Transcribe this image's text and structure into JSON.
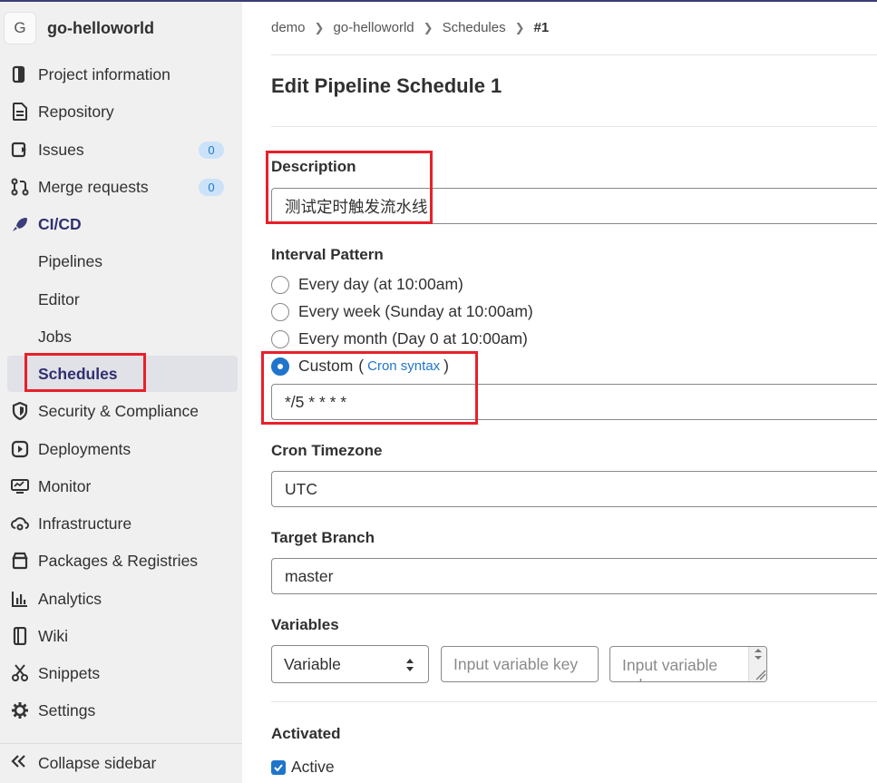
{
  "project": {
    "avatar_letter": "G",
    "name": "go-helloworld"
  },
  "sidebar": {
    "items": [
      {
        "label": "Project information"
      },
      {
        "label": "Repository"
      },
      {
        "label": "Issues",
        "badge": "0"
      },
      {
        "label": "Merge requests",
        "badge": "0"
      },
      {
        "label": "CI/CD"
      },
      {
        "label": "Pipelines"
      },
      {
        "label": "Editor"
      },
      {
        "label": "Jobs"
      },
      {
        "label": "Schedules"
      },
      {
        "label": "Security & Compliance"
      },
      {
        "label": "Deployments"
      },
      {
        "label": "Monitor"
      },
      {
        "label": "Infrastructure"
      },
      {
        "label": "Packages & Registries"
      },
      {
        "label": "Analytics"
      },
      {
        "label": "Wiki"
      },
      {
        "label": "Snippets"
      },
      {
        "label": "Settings"
      }
    ],
    "collapse_label": "Collapse sidebar"
  },
  "breadcrumb": [
    "demo",
    "go-helloworld",
    "Schedules",
    "#1"
  ],
  "page_title": "Edit Pipeline Schedule 1",
  "form": {
    "description_label": "Description",
    "description_value": "测试定时触发流水线",
    "interval_label": "Interval Pattern",
    "interval_options": [
      "Every day (at 10:00am)",
      "Every week (Sunday at 10:00am)",
      "Every month (Day 0 at 10:00am)",
      "Custom"
    ],
    "cron_open": "(",
    "cron_link": "Cron syntax",
    "cron_close": ")",
    "cron_value": "*/5 * * * *",
    "timezone_label": "Cron Timezone",
    "timezone_value": "UTC",
    "branch_label": "Target Branch",
    "branch_value": "master",
    "variables_label": "Variables",
    "variable_type": "Variable",
    "variable_key_placeholder": "Input variable key",
    "variable_value_placeholder": "Input variable value",
    "activated_label": "Activated",
    "active_label": "Active"
  },
  "colors": {
    "accent": "#1f75cb",
    "highlight": "#e8202a",
    "sidebar_bg": "#f0f0f0"
  }
}
